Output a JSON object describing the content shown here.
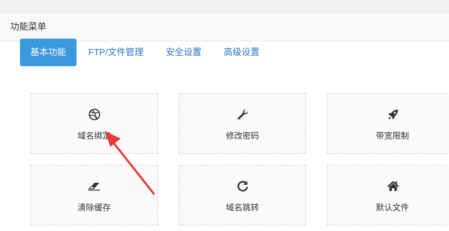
{
  "panel": {
    "title": "功能菜单"
  },
  "tabs": [
    {
      "label": "基本功能",
      "active": true
    },
    {
      "label": "FTP/文件管理",
      "active": false
    },
    {
      "label": "安全设置",
      "active": false
    },
    {
      "label": "高级设置",
      "active": false
    }
  ],
  "cards": [
    {
      "label": "域名绑定",
      "icon": "dribbble-icon"
    },
    {
      "label": "修改密码",
      "icon": "wrench-icon"
    },
    {
      "label": "带宽限制",
      "icon": "rocket-icon"
    },
    {
      "label": "清除缓存",
      "icon": "eraser-icon"
    },
    {
      "label": "域名跳转",
      "icon": "refresh-icon"
    },
    {
      "label": "默认文件",
      "icon": "home-icon"
    }
  ],
  "colors": {
    "accent": "#3a98dd",
    "tab_text": "#2a79c6",
    "annotation_arrow": "#e53935"
  }
}
